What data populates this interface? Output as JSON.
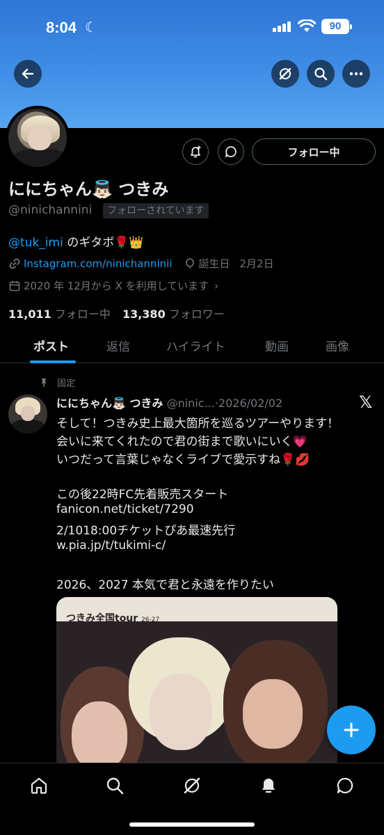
{
  "status_bar": {
    "time": "8:04",
    "battery": "90"
  },
  "profile": {
    "display_name": "ににちゃん👼🏻 つきみ",
    "handle": "@ninichannini",
    "follows_you": "フォローされています",
    "follow_button": "フォロー中",
    "bio_mention": "@tuk_imi",
    "bio_text": " のギタボ🌹👑",
    "website": "Instagram.com/ninichanninii",
    "birthday_label": "誕生日",
    "birthday_value": "2月2日",
    "joined": "2020 年 12月から X を利用しています",
    "following_count": "11,011",
    "following_label": "フォロー中",
    "followers_count": "13,380",
    "followers_label": "フォロワー"
  },
  "tabs": [
    {
      "label": "ポスト"
    },
    {
      "label": "返信"
    },
    {
      "label": "ハイライト"
    },
    {
      "label": "動画"
    },
    {
      "label": "画像"
    }
  ],
  "post": {
    "pinned_label": "固定",
    "author_name": "ににちゃん👼🏻 つきみ",
    "author_handle": "@ninic...",
    "separator": "·",
    "date": "2026/02/02",
    "lines": {
      "l1": "そして！つきみ史上最大箇所を巡るツアーやります！",
      "l2": "会いに来てくれたので君の街まで歌いにいく💗",
      "l3": "いつだって言葉じゃなくライブで愛示すね🌹💋",
      "l4": "この後22時FC先着販売スタート",
      "l5": "fanicon.net/ticket/7290",
      "l6": "2/1018:00チケットぴあ最速先行",
      "l7": "w.pia.jp/t/tukimi-c/",
      "l8": "2026、2027 本気で君と永遠を作りたい"
    },
    "media_caption": "つきみ全国tour",
    "media_caption_small": "26-27"
  },
  "colors": {
    "accent": "#1d9bf0",
    "banner": "#3f8de6",
    "background": "#000000",
    "muted": "#71767b"
  }
}
